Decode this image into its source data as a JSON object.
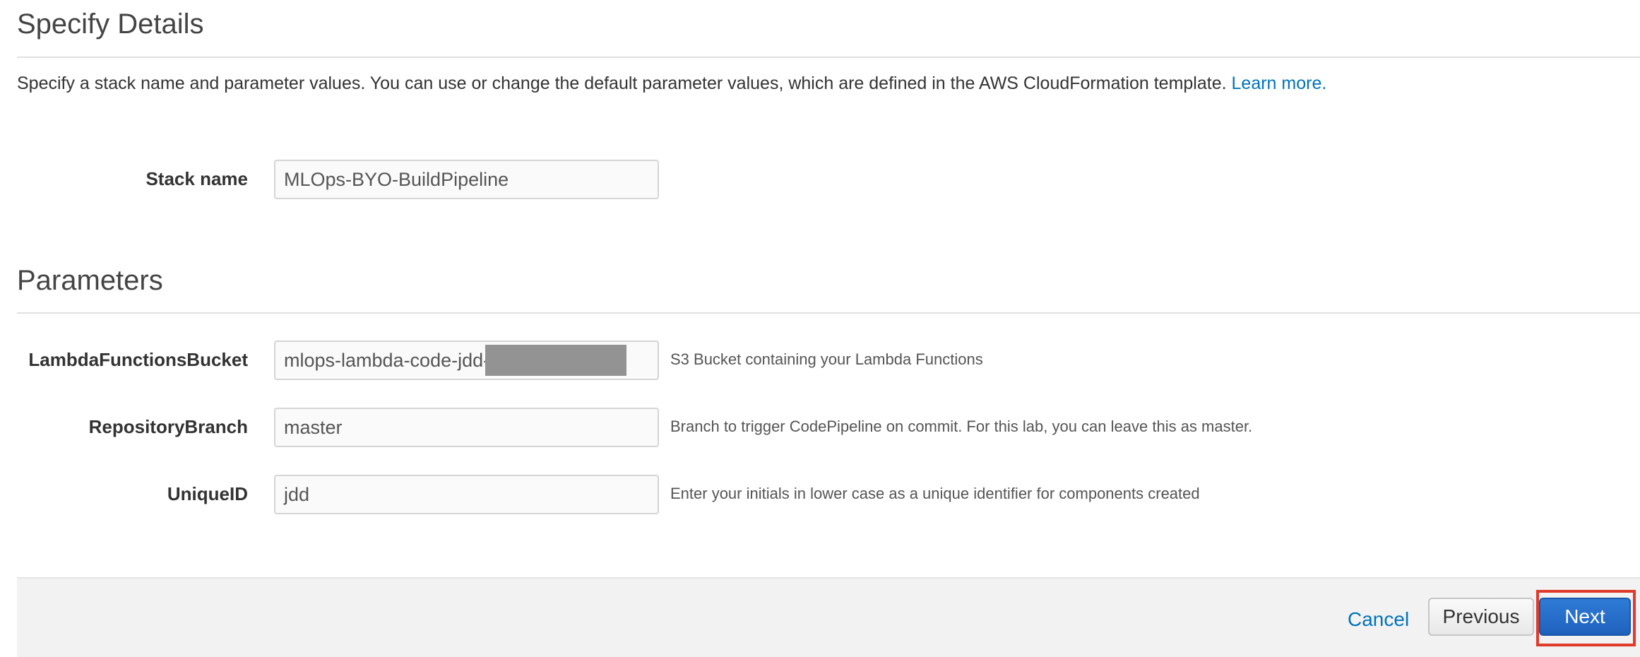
{
  "details": {
    "title": "Specify Details",
    "description": "Specify a stack name and parameter values. You can use or change the default parameter values, which are defined in the AWS CloudFormation template.",
    "learn_more": "Learn more.",
    "stack_name_label": "Stack name",
    "stack_name_value": "MLOps-BYO-BuildPipeline"
  },
  "parameters": {
    "title": "Parameters",
    "items": [
      {
        "label": "LambdaFunctionsBucket",
        "value": "mlops-lambda-code-jdd-",
        "hint": "S3 Bucket containing your Lambda Functions"
      },
      {
        "label": "RepositoryBranch",
        "value": "master",
        "hint": "Branch to trigger CodePipeline on commit. For this lab, you can leave this as master."
      },
      {
        "label": "UniqueID",
        "value": "jdd",
        "hint": "Enter your initials in lower case as a unique identifier for components created"
      }
    ]
  },
  "footer": {
    "cancel": "Cancel",
    "previous": "Previous",
    "next": "Next"
  },
  "colors": {
    "link": "#0073bb",
    "primary_button": "#1f62be",
    "highlight": "#e03b2a"
  }
}
